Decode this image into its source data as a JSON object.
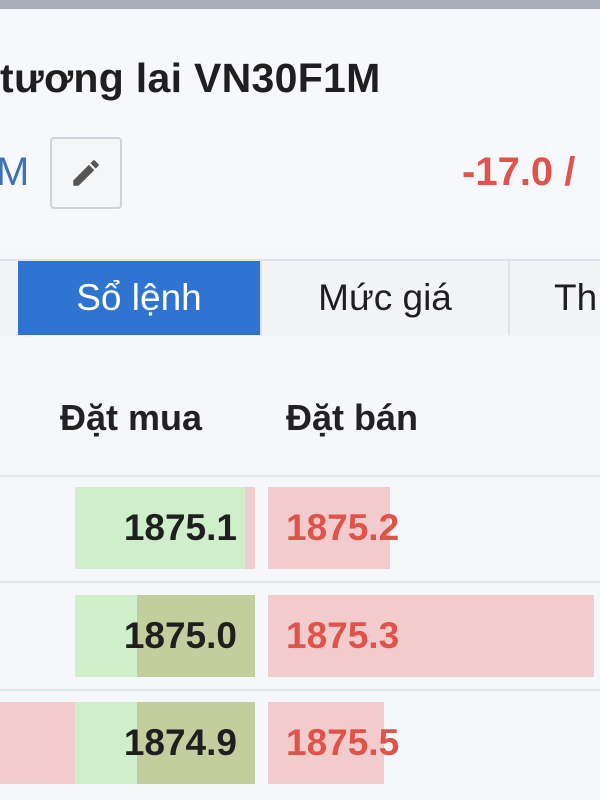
{
  "header": {
    "title": "tương lai VN30F1M",
    "symbol_fragment": "M",
    "change": "-17.0 /"
  },
  "tabs": [
    {
      "label": "Sổ lệnh",
      "active": true
    },
    {
      "label": "Mức giá",
      "active": false
    },
    {
      "label": "Th",
      "active": false
    }
  ],
  "order_book": {
    "bid_header": "Đặt mua",
    "ask_header": "Đặt bán",
    "rows": [
      {
        "bid": "1875.1",
        "ask": "1875.2"
      },
      {
        "bid": "1875.0",
        "ask": "1875.3"
      },
      {
        "bid": "1874.9",
        "ask": "1875.5"
      }
    ]
  },
  "colors": {
    "accent": "#2f74d0",
    "ask_red": "#e0534a",
    "bid_green": "#cfeeca",
    "ask_pink": "#f2cccc"
  }
}
